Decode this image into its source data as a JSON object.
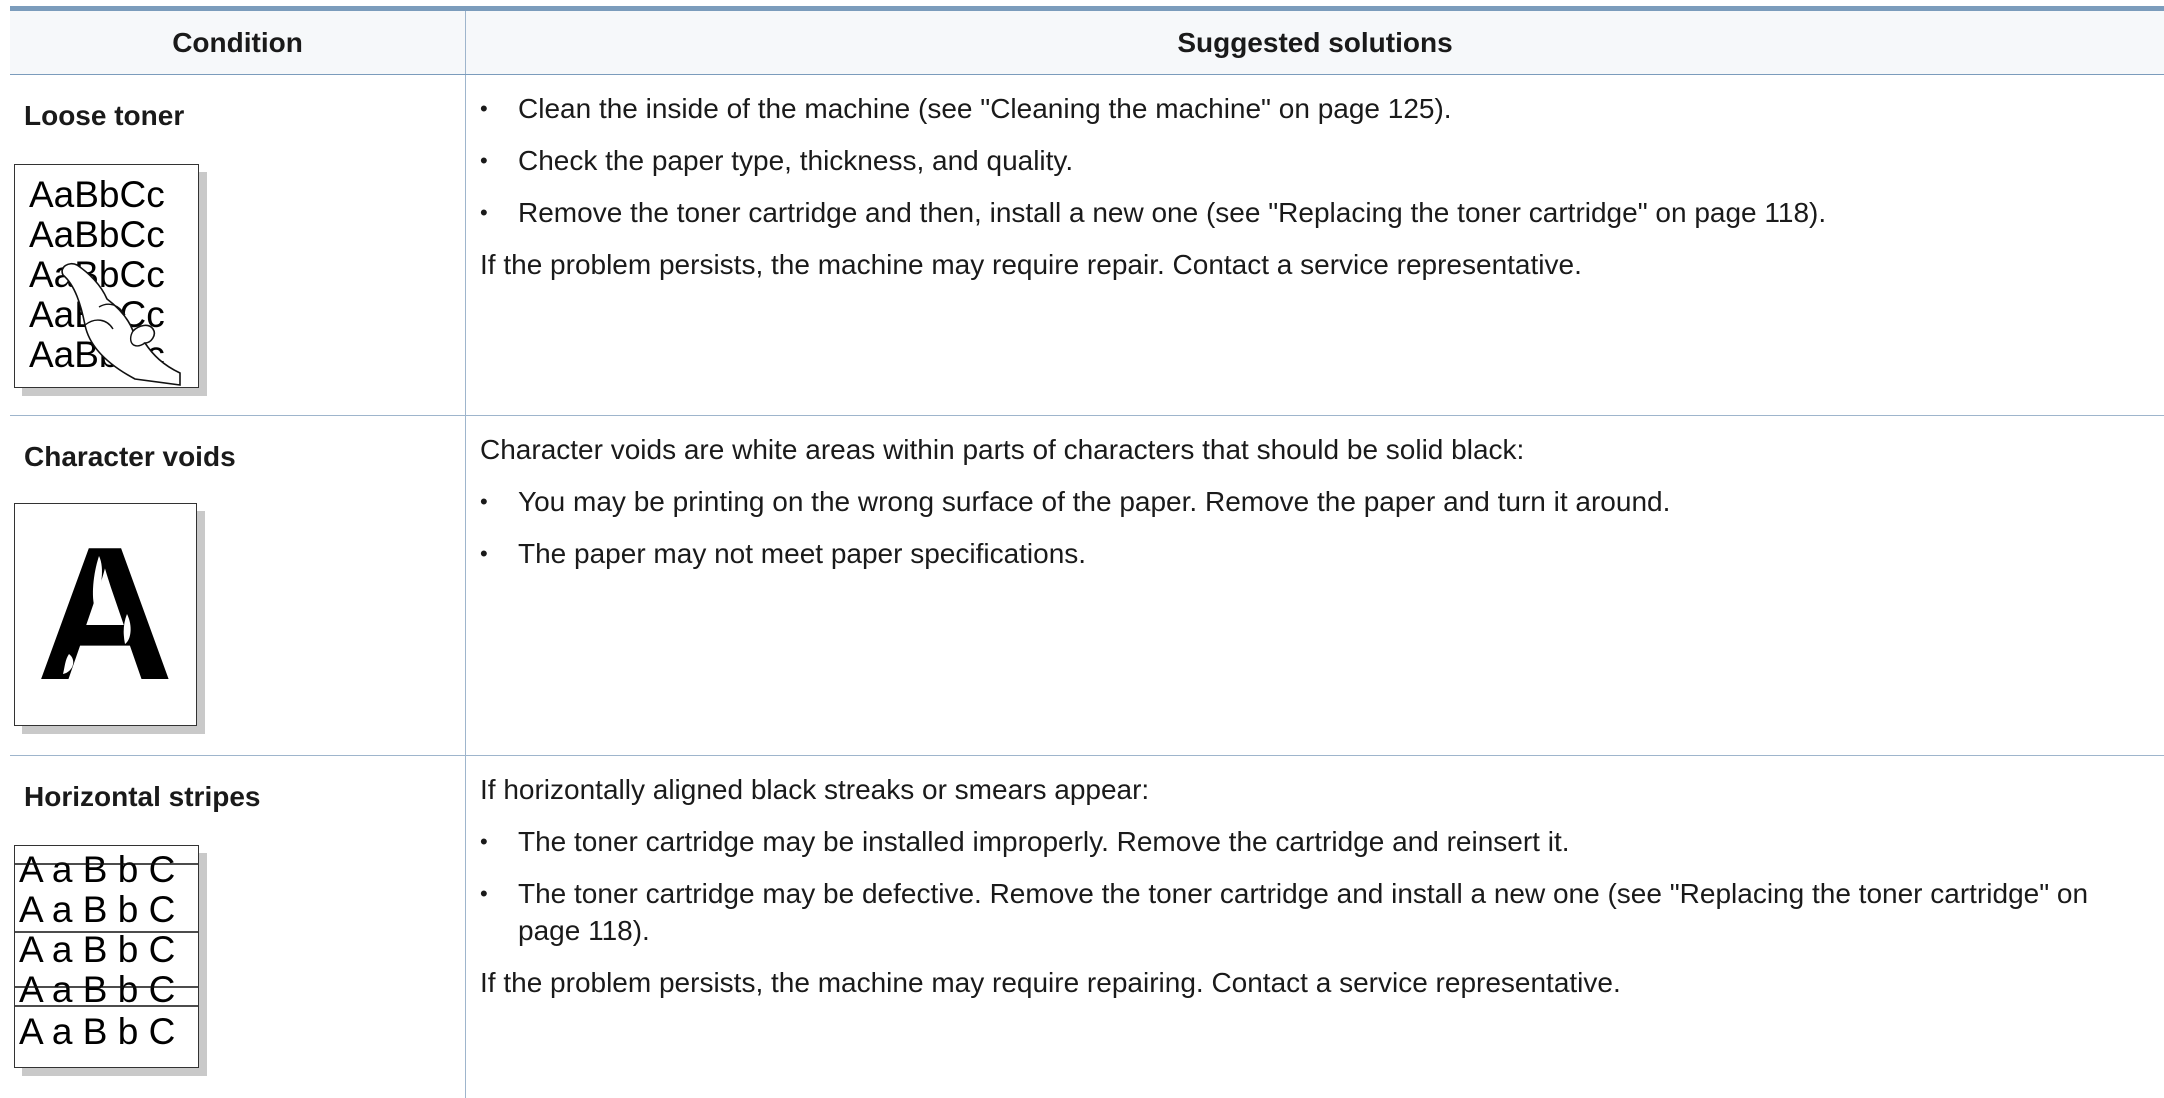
{
  "table": {
    "headers": {
      "condition": "Condition",
      "solutions": "Suggested solutions"
    },
    "rows": [
      {
        "condition": "Loose toner",
        "sample_image": "loose-toner-sample",
        "sample_text": [
          "AaBbCc",
          "AaBbCc",
          "AaBbCc",
          "AaBbCc",
          "AaBbCc"
        ],
        "intro": "",
        "bullets": [
          "Clean the inside of the machine (see \"Cleaning the machine\" on page 125).",
          "Check the paper type, thickness, and quality.",
          "Remove the toner cartridge and then, install a new one (see \"Replacing the toner cartridge\" on page 118)."
        ],
        "footer": "If the problem persists, the machine may require repair. Contact a service representative."
      },
      {
        "condition": "Character voids",
        "sample_image": "character-voids-sample",
        "sample_text": [
          "A"
        ],
        "intro": "Character voids are white areas within parts of characters that should be solid black:",
        "bullets": [
          "You may be printing on the wrong surface of the paper. Remove the paper and turn it around.",
          "The paper may not meet paper specifications."
        ],
        "footer": ""
      },
      {
        "condition": "Horizontal stripes",
        "sample_image": "horizontal-stripes-sample",
        "sample_text": [
          "A a B b C",
          "A a B b C",
          "A a B b C",
          "A a B b C",
          "A a B b C"
        ],
        "intro": "If horizontally aligned black streaks or smears appear:",
        "bullets": [
          "The toner cartridge may be installed improperly. Remove the cartridge and reinsert it.",
          "The toner cartridge may be defective. Remove the toner cartridge and install a new one (see \"Replacing the toner cartridge\" on page 118)."
        ],
        "footer": "If the problem persists, the machine may require repairing. Contact a service representative."
      }
    ]
  }
}
